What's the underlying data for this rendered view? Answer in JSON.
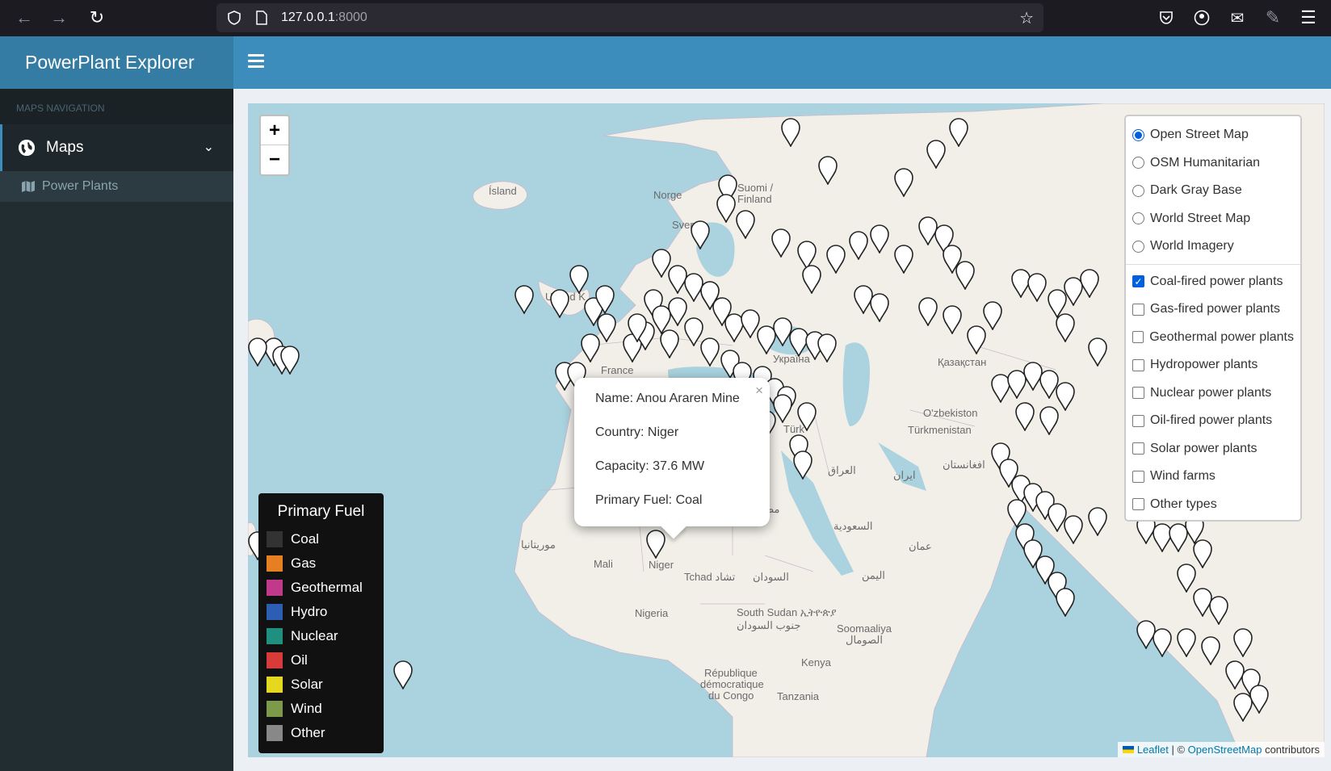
{
  "browser": {
    "url_host": "127.0.0.1",
    "url_port": ":8000"
  },
  "app": {
    "brand": "PowerPlant Explorer"
  },
  "sidebar": {
    "header": "MAPS NAVIGATION",
    "menu_label": "Maps",
    "submenu_label": "Power Plants"
  },
  "map": {
    "zoom_in": "+",
    "zoom_out": "−",
    "labels": {
      "island": "Ísland",
      "norge": "Norge",
      "suomi": "Suomi /",
      "finland": "Finland",
      "sverige": "Sver",
      "united_kingdom": "United K",
      "france": "France",
      "ukraina": "Україна",
      "kazakhstan": "Қазақстан",
      "uzbekistan": "O'zbekiston",
      "turkmenistan": "Türkmenistan",
      "turkiye": "Türk",
      "iraq": "العراق",
      "iran": "ایران",
      "afghanistan": "افغانستان",
      "egypt": "مصر",
      "saudi": "السعودية",
      "oman": "عمان",
      "yemen": "اليمن",
      "mauritania": "موريتانيا",
      "mali": "Mali",
      "niger": "Niger",
      "tchad": "Tchad تشاد",
      "sudan": "السودان",
      "nigeria": "Nigeria",
      "south_sudan": "South Sudan ኢትዮጵያ",
      "south_sudan_ar": "جنوب السودان",
      "somalia": "Soomaaliya",
      "somalia_ar": "الصومال",
      "kenya": "Kenya",
      "drc_1": "République",
      "drc_2": "démocratique",
      "drc_3": "du Congo",
      "tanzania": "Tanzania"
    },
    "popup": {
      "name": "Name: Anou Araren Mine",
      "country": "Country: Niger",
      "capacity": "Capacity: 37.6 MW",
      "fuel": "Primary Fuel: Coal",
      "close": "×"
    },
    "attribution": {
      "leaflet": "Leaflet",
      "sep": " | © ",
      "osm": "OpenStreetMap",
      "contributors": " contributors"
    }
  },
  "layer_control": {
    "base_layers": [
      {
        "label": "Open Street Map",
        "selected": true
      },
      {
        "label": "OSM Humanitarian",
        "selected": false
      },
      {
        "label": "Dark Gray Base",
        "selected": false
      },
      {
        "label": "World Street Map",
        "selected": false
      },
      {
        "label": "World Imagery",
        "selected": false
      }
    ],
    "overlays": [
      {
        "label": "Coal-fired power plants",
        "checked": true
      },
      {
        "label": "Gas-fired power plants",
        "checked": false
      },
      {
        "label": "Geothermal power plants",
        "checked": false
      },
      {
        "label": "Hydropower plants",
        "checked": false
      },
      {
        "label": "Nuclear power plants",
        "checked": false
      },
      {
        "label": "Oil-fired power plants",
        "checked": false
      },
      {
        "label": "Solar power plants",
        "checked": false
      },
      {
        "label": "Wind farms",
        "checked": false
      },
      {
        "label": "Other types",
        "checked": false
      }
    ]
  },
  "legend": {
    "title": "Primary Fuel",
    "items": [
      {
        "label": "Coal",
        "color": "#333333"
      },
      {
        "label": "Gas",
        "color": "#e67e22"
      },
      {
        "label": "Geothermal",
        "color": "#c0398a"
      },
      {
        "label": "Hydro",
        "color": "#2c5fb3"
      },
      {
        "label": "Nuclear",
        "color": "#1f8f7e"
      },
      {
        "label": "Oil",
        "color": "#d93a3a"
      },
      {
        "label": "Solar",
        "color": "#e6d81f"
      },
      {
        "label": "Wind",
        "color": "#7d9a4a"
      },
      {
        "label": "Other",
        "color": "#888888"
      }
    ]
  }
}
